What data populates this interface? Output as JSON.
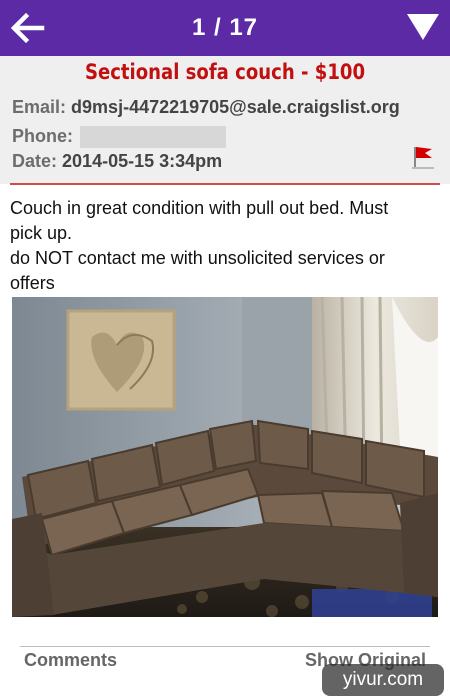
{
  "nav": {
    "counter": "1 / 17",
    "back_icon": "arrow-left-icon",
    "menu_icon": "triangle-down-icon"
  },
  "listing": {
    "title": "Sectional sofa couch - $100",
    "email_label": "Email:",
    "email": "d9msj-4472219705@sale.craigslist.org",
    "phone_label": "Phone:",
    "phone": "",
    "date_label": "Date:",
    "date": "2014-05-15 3:34pm",
    "flag_icon": "red-flag-icon"
  },
  "description": {
    "lines": [
      "Couch in great condition with pull out bed. Must",
      "pick up.",
      "do NOT contact me with unsolicited services or",
      "offers"
    ]
  },
  "photo": {
    "subject": "sectional-sofa-photo"
  },
  "footer": {
    "comments_label": "Comments",
    "show_original_label": "Show Original"
  },
  "watermark": {
    "text": "yivur.com"
  },
  "colors": {
    "topbar": "#5c2aa5",
    "title": "#c21010",
    "divider": "#d24a4a"
  }
}
